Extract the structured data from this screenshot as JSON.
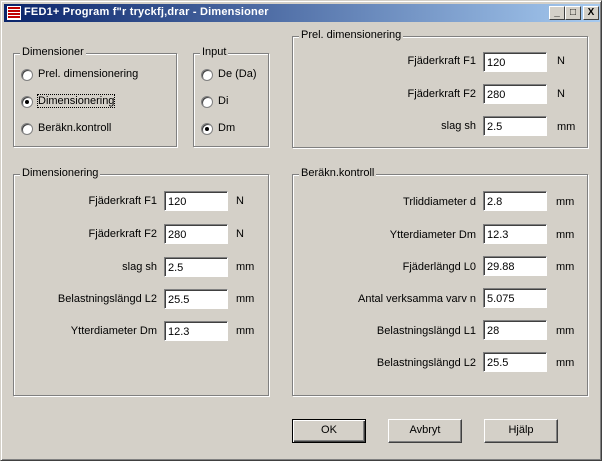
{
  "window": {
    "title": "FED1+  Program f\"r tryckfj‚drar - Dimensioner"
  },
  "titlebar_buttons": {
    "minimize": "_",
    "maximize": "□",
    "close": "X"
  },
  "dimensioner_group": {
    "title": "Dimensioner",
    "options": [
      "Prel. dimensionering",
      "Dimensionering",
      "Beräkn.kontroll"
    ],
    "selected": "Dimensionering"
  },
  "input_group": {
    "title": "Input",
    "options": [
      "De (Da)",
      "Di",
      "Dm"
    ],
    "selected": "Dm"
  },
  "prel_group": {
    "title": "Prel. dimensionering",
    "rows": [
      {
        "label": "Fjäderkraft F1",
        "value": "120",
        "unit": "N"
      },
      {
        "label": "Fjäderkraft F2",
        "value": "280",
        "unit": "N"
      },
      {
        "label": "slag sh",
        "value": "2.5",
        "unit": "mm"
      }
    ]
  },
  "dim_group": {
    "title": "Dimensionering",
    "rows": [
      {
        "label": "Fjäderkraft F1",
        "value": "120",
        "unit": "N"
      },
      {
        "label": "Fjäderkraft F2",
        "value": "280",
        "unit": "N"
      },
      {
        "label": "slag sh",
        "value": "2.5",
        "unit": "mm"
      },
      {
        "label": "Belastningslängd L2",
        "value": "25.5",
        "unit": "mm"
      },
      {
        "label": "Ytterdiameter Dm",
        "value": "12.3",
        "unit": "mm"
      }
    ]
  },
  "kontroll_group": {
    "title": "Beräkn.kontroll",
    "rows": [
      {
        "label": "Trliddiameter d",
        "value": "2.8",
        "unit": "mm"
      },
      {
        "label": "Ytterdiameter Dm",
        "value": "12.3",
        "unit": "mm"
      },
      {
        "label": "Fjäderlängd L0",
        "value": "29.88",
        "unit": "mm"
      },
      {
        "label": "Antal verksamma varv n",
        "value": "5.075",
        "unit": ""
      },
      {
        "label": "Belastningslängd L1",
        "value": "28",
        "unit": "mm"
      },
      {
        "label": "Belastningslängd L2",
        "value": "25.5",
        "unit": "mm"
      }
    ]
  },
  "buttons": {
    "ok": "OK",
    "cancel": "Avbryt",
    "help": "Hjälp"
  },
  "colors": {
    "face": "#d4d0c8",
    "title_start": "#0a246a",
    "title_end": "#a6caf0"
  }
}
